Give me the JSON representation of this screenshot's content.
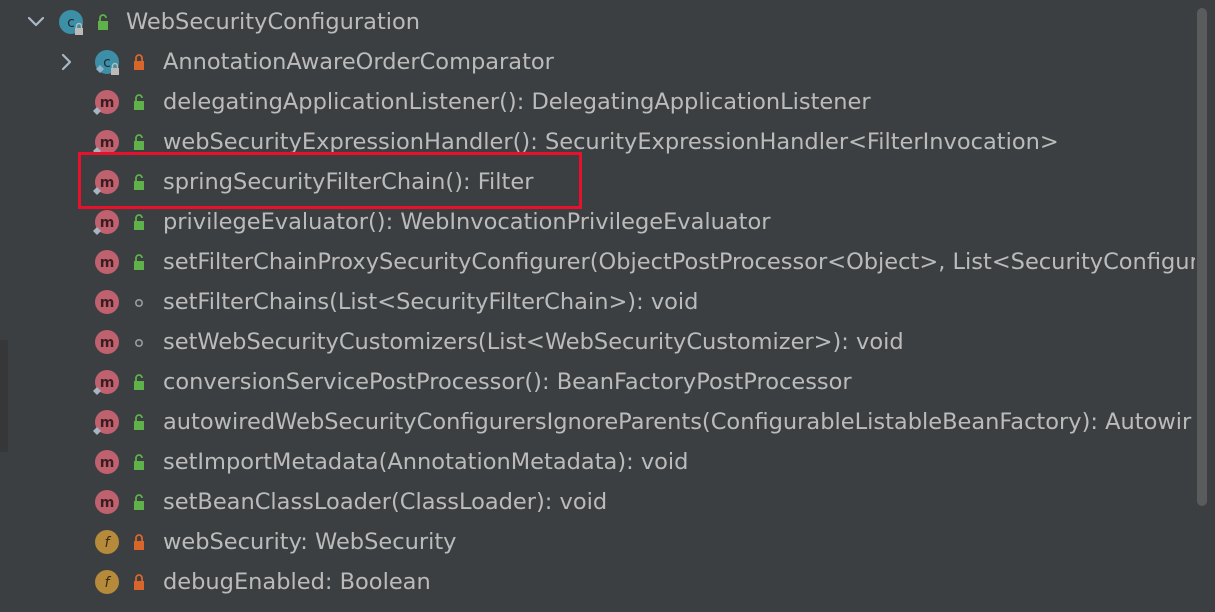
{
  "tree": {
    "root": {
      "label": "WebSecurityConfiguration",
      "expanded": true,
      "icon": "class-icon",
      "visibility": "public"
    },
    "items": [
      {
        "label": "AnnotationAwareOrderComparator",
        "icon": "class-icon",
        "visibility": "private",
        "expandable": true
      },
      {
        "label": "delegatingApplicationListener(): DelegatingApplicationListener",
        "icon": "method-icon",
        "visibility": "public",
        "bean": true
      },
      {
        "label": "webSecurityExpressionHandler(): SecurityExpressionHandler<FilterInvocation>",
        "icon": "method-icon",
        "visibility": "public",
        "bean": true
      },
      {
        "label": "springSecurityFilterChain(): Filter",
        "icon": "method-icon",
        "visibility": "public",
        "bean": true
      },
      {
        "label": "privilegeEvaluator(): WebInvocationPrivilegeEvaluator",
        "icon": "method-icon",
        "visibility": "public",
        "bean": true
      },
      {
        "label": "setFilterChainProxySecurityConfigurer(ObjectPostProcessor<Object>, List<SecurityConfigur",
        "icon": "method-icon",
        "visibility": "public"
      },
      {
        "label": "setFilterChains(List<SecurityFilterChain>): void",
        "icon": "method-icon",
        "visibility": "package"
      },
      {
        "label": "setWebSecurityCustomizers(List<WebSecurityCustomizer>): void",
        "icon": "method-icon",
        "visibility": "package"
      },
      {
        "label": "conversionServicePostProcessor(): BeanFactoryPostProcessor",
        "icon": "method-icon",
        "visibility": "public",
        "bean": true
      },
      {
        "label": "autowiredWebSecurityConfigurersIgnoreParents(ConfigurableListableBeanFactory): Autowir",
        "icon": "method-icon",
        "visibility": "public",
        "bean": true
      },
      {
        "label": "setImportMetadata(AnnotationMetadata): void",
        "icon": "method-icon",
        "visibility": "public"
      },
      {
        "label": "setBeanClassLoader(ClassLoader): void",
        "icon": "method-icon",
        "visibility": "public"
      },
      {
        "label": "webSecurity: WebSecurity",
        "icon": "field-icon",
        "visibility": "private"
      },
      {
        "label": "debugEnabled: Boolean",
        "icon": "field-icon",
        "visibility": "private"
      }
    ]
  },
  "highlight": {
    "target": "springSecurityFilterChain(): Filter",
    "color": "#e8102a"
  },
  "colors": {
    "background": "#3c3f41",
    "text": "#bbbbbb",
    "class_icon": "#3d8fa8",
    "method_icon": "#c0616f",
    "field_icon": "#b58a3a",
    "public_lock": "#5fb14a",
    "private_lock": "#d8662b"
  }
}
